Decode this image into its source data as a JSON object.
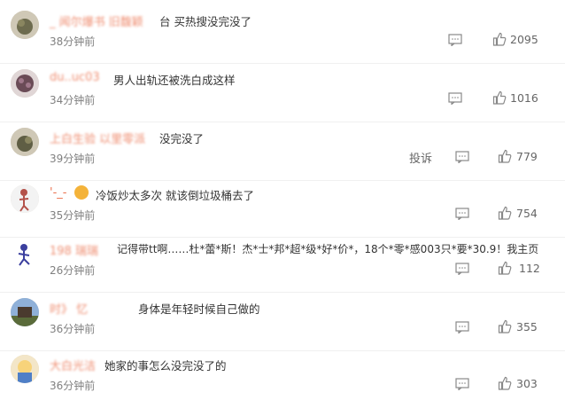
{
  "comments": [
    {
      "name": "_ 闻尔爆书 旧馥颖",
      "text": "台 买热搜没完没了",
      "time": "38分钟前",
      "likes": "2095"
    },
    {
      "name": "du..uc03",
      "text": "男人出轨还被洗白成这样",
      "time": "34分钟前",
      "likes": "1016"
    },
    {
      "name": "上白生验 以里零派",
      "text": "没完没了",
      "time": "39分钟前",
      "likes": "779",
      "report": "投诉"
    },
    {
      "name": "'-_-",
      "text": "冷饭炒太多次 就该倒垃圾桶去了",
      "time": "35分钟前",
      "likes": "754"
    },
    {
      "name": "198  瑞瑞",
      "text": "记得带tt啊……杜*蕾*斯！杰*士*邦*超*级*好*价*，18个*零*感003只*要*30.9！我主页",
      "time": "26分钟前",
      "likes": "112"
    },
    {
      "name": "时》        忆",
      "text": "身体是年轻时候自己做的",
      "time": "36分钟前",
      "likes": "355"
    },
    {
      "name": "大白光洁",
      "text": "她家的事怎么没完没了的",
      "time": "36分钟前",
      "likes": "303"
    }
  ]
}
